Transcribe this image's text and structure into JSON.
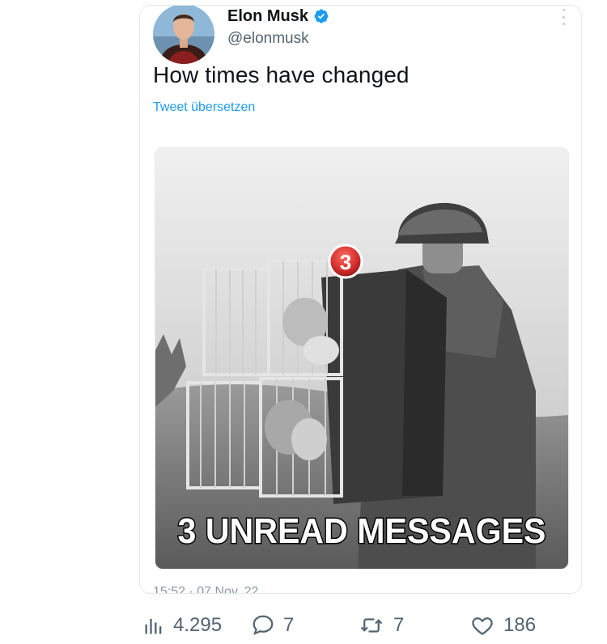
{
  "tweet": {
    "author_name": "Elon Musk",
    "author_handle": "@elonmusk",
    "text": "How times have changed",
    "translate_label": "Tweet übersetzen",
    "timestamp": "15:52 · 07 Nov. 22",
    "media": {
      "badge_count": "3",
      "caption": "3 UNREAD MESSAGES"
    }
  },
  "actions": {
    "views": "4.295",
    "replies": "7",
    "retweets": "7",
    "likes": "186"
  },
  "colors": {
    "verified": "#1d9bf0",
    "link": "#1d9bf0",
    "secondary_text": "#536471",
    "badge_red": "#d32f2f"
  },
  "icons": {
    "verified": "verified-badge-icon",
    "views": "bar-chart-icon",
    "replies": "speech-bubble-icon",
    "retweets": "retweet-icon",
    "likes": "heart-icon",
    "more": "vertical-dots-icon"
  }
}
